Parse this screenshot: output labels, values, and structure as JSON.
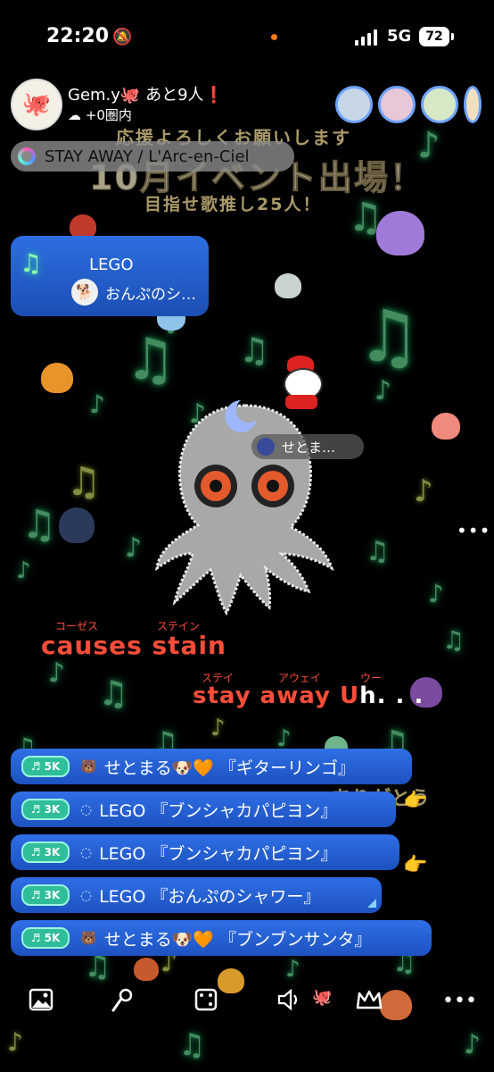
{
  "status_bar": {
    "time": "22:20",
    "network": "5G",
    "battery": "72"
  },
  "header": {
    "username": "Gem.y🐙 あと9人",
    "username_mark": "❗",
    "points": "+0圏内"
  },
  "song_chip": {
    "label": "STAY AWAY / L'Arc-en-Ciel"
  },
  "banner": {
    "line1": "応援よろしくお願いします",
    "line2": "10月イベント出場！",
    "line3": "目指せ歌推し25人！"
  },
  "now_playing": {
    "title": "LEGO",
    "user": "おんぷのシ…"
  },
  "center": {
    "user_chip": "せとま…",
    "more": "•••"
  },
  "lyrics": {
    "ruby1": "コーゼス",
    "ruby2": "ステイン",
    "line1": "causes stain",
    "ruby3": "ステイ",
    "ruby4": "アウェイ",
    "ruby5": "ウー",
    "line2_red": "stay away U",
    "line2_white": "h. . ."
  },
  "gifts": [
    {
      "badge": "♬ 5K",
      "text": "せとまる🐶🧡 『ギターリンゴ』"
    },
    {
      "badge": "♬ 3K",
      "text": "LEGO 『ブンシャカパピヨン』"
    },
    {
      "badge": "♬ 3K",
      "text": "LEGO 『ブンシャカパピヨン』"
    },
    {
      "badge": "♬ 3K",
      "text": "LEGO 『おんぷのシャワー』"
    },
    {
      "badge": "♬ 5K",
      "text": "せとまる🐶🧡 『ブンブンサンタ』"
    }
  ],
  "side_text": "ありがとう",
  "bottom_bar": {
    "icons": [
      "image-icon",
      "microphone-icon",
      "dice-icon",
      "volume-icon",
      "crown-icon",
      "more-icon"
    ]
  },
  "colors": {
    "accent_blue": "#2d6fe0",
    "lyric_red": "#ff4d3a",
    "note_green": "#7dffb0",
    "badge_teal": "#2fbd9a"
  }
}
